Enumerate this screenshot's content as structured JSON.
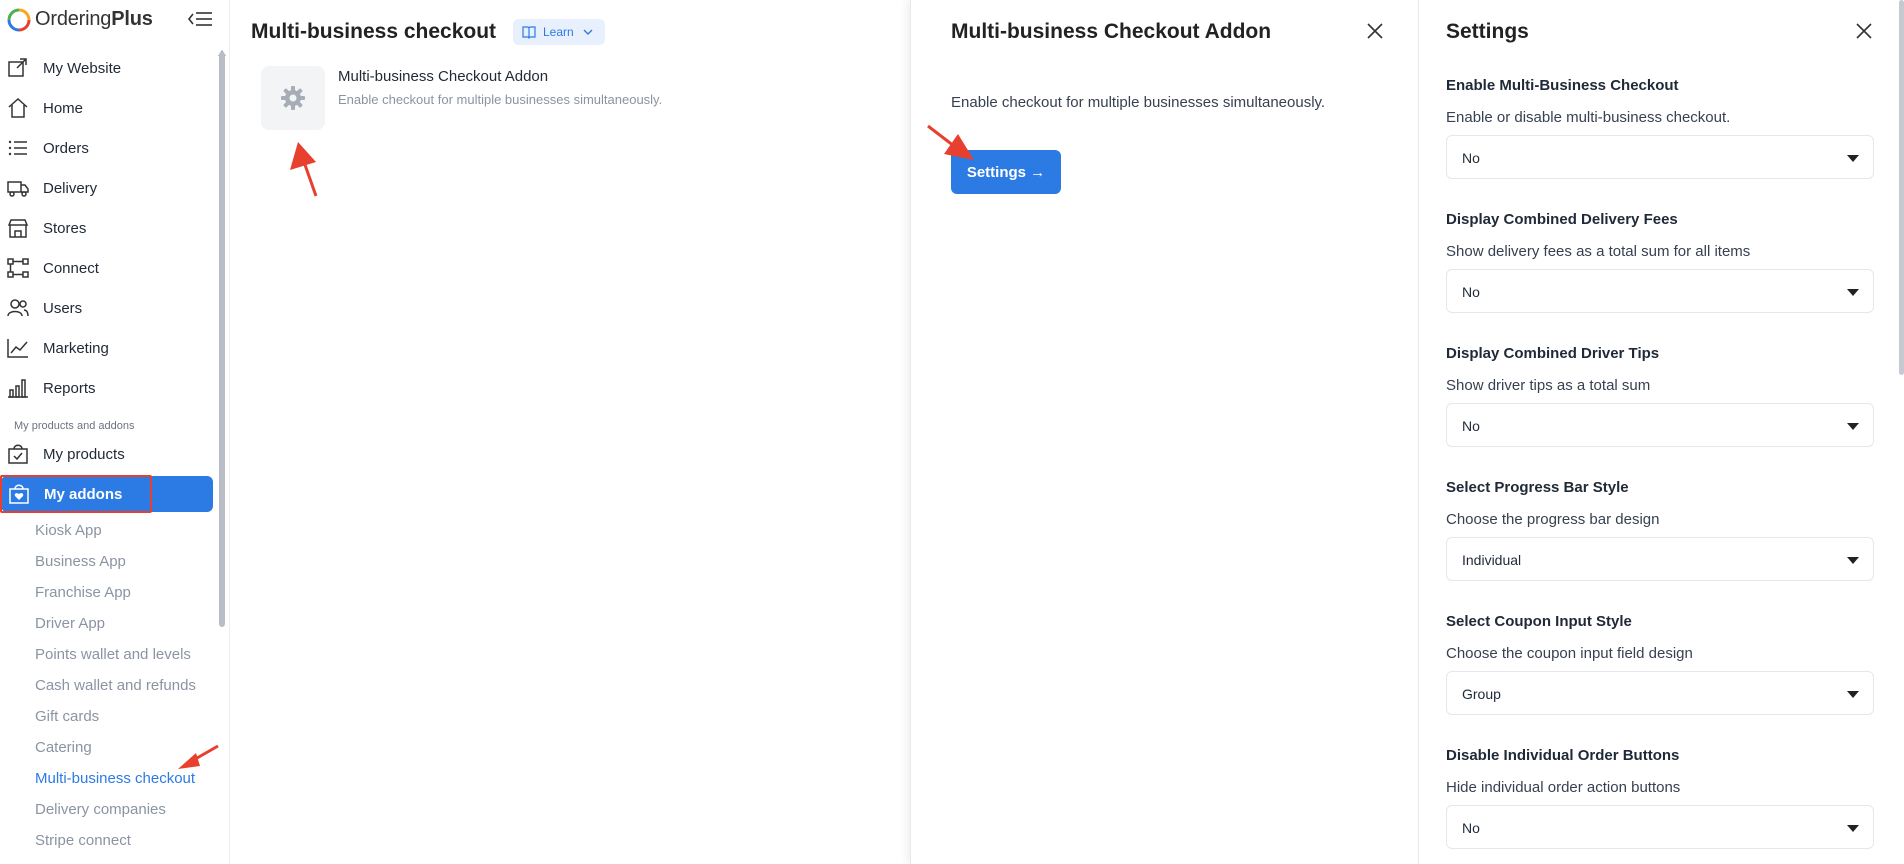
{
  "brand": {
    "name_regular": "Ordering",
    "name_bold": "Plus"
  },
  "sidebar": {
    "items": [
      {
        "label": "My Website",
        "icon": "external-link-icon"
      },
      {
        "label": "Home",
        "icon": "home-icon"
      },
      {
        "label": "Orders",
        "icon": "list-icon"
      },
      {
        "label": "Delivery",
        "icon": "truck-icon"
      },
      {
        "label": "Stores",
        "icon": "store-icon"
      },
      {
        "label": "Connect",
        "icon": "nodes-icon"
      },
      {
        "label": "Users",
        "icon": "users-icon"
      },
      {
        "label": "Marketing",
        "icon": "chart-line-icon"
      },
      {
        "label": "Reports",
        "icon": "bar-chart-icon"
      }
    ],
    "section_title": "My products and addons",
    "my_products": "My products",
    "my_addons": "My addons",
    "sub_items": [
      "Kiosk App",
      "Business App",
      "Franchise App",
      "Driver App",
      "Points wallet and levels",
      "Cash wallet and refunds",
      "Gift cards",
      "Catering",
      "Multi-business checkout",
      "Delivery companies",
      "Stripe connect"
    ]
  },
  "main": {
    "title": "Multi-business checkout",
    "learn_label": "Learn",
    "addon": {
      "name": "Multi-business Checkout Addon",
      "description": "Enable checkout for multiple businesses simultaneously."
    }
  },
  "addon_panel": {
    "title": "Multi-business Checkout Addon",
    "description": "Enable checkout for multiple businesses simultaneously.",
    "settings_button": "Settings →"
  },
  "settings_panel": {
    "title": "Settings",
    "settings": [
      {
        "title": "Enable Multi-Business Checkout",
        "description": "Enable or disable multi-business checkout.",
        "value": "No"
      },
      {
        "title": "Display Combined Delivery Fees",
        "description": "Show delivery fees as a total sum for all items",
        "value": "No"
      },
      {
        "title": "Display Combined Driver Tips",
        "description": "Show driver tips as a total sum",
        "value": "No"
      },
      {
        "title": "Select Progress Bar Style",
        "description": "Choose the progress bar design",
        "value": "Individual"
      },
      {
        "title": "Select Coupon Input Style",
        "description": "Choose the coupon input field design",
        "value": "Group"
      },
      {
        "title": "Disable Individual Order Buttons",
        "description": "Hide individual order action buttons",
        "value": "No"
      }
    ]
  },
  "colors": {
    "accent": "#2c7be5",
    "annotation": "#e8402f",
    "muted_text": "#8a94a3"
  }
}
